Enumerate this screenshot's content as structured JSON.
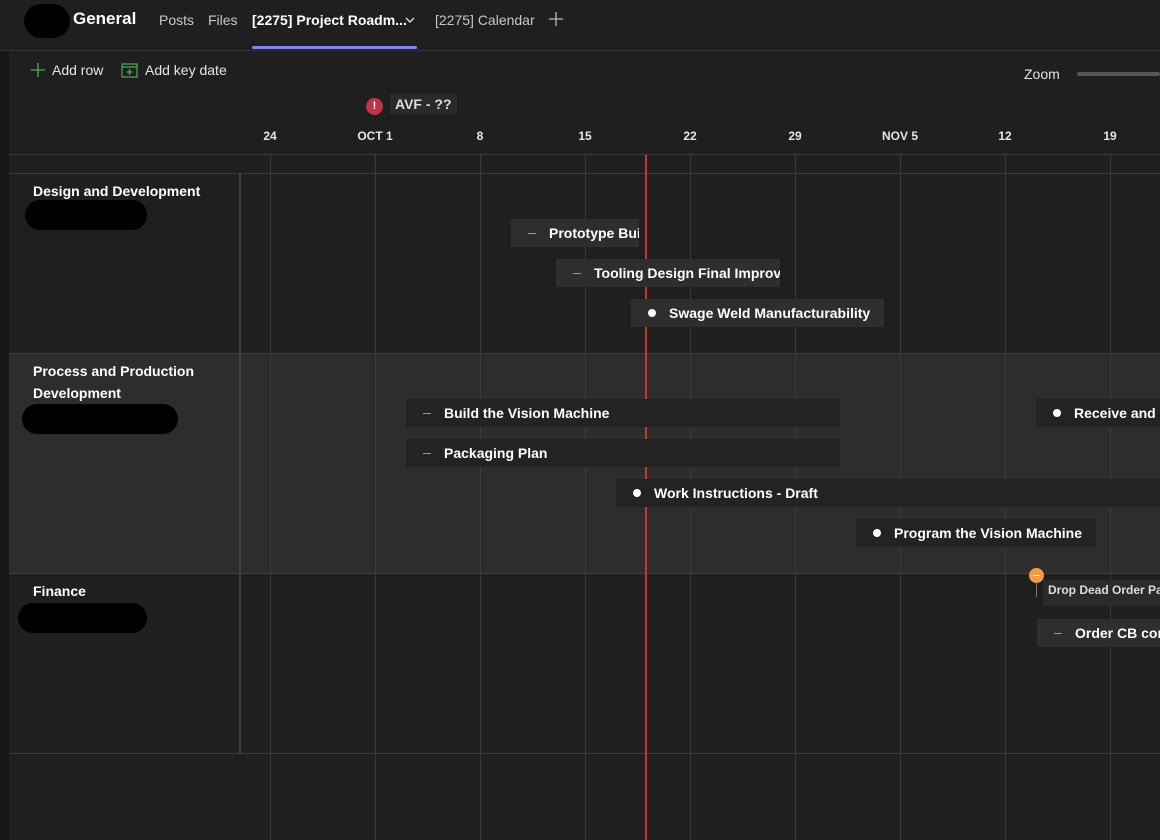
{
  "header": {
    "channel": "General",
    "tabs": [
      {
        "label": "Posts"
      },
      {
        "label": "Files"
      },
      {
        "label": "[2275] Project Roadm..."
      },
      {
        "label": "[2275] Calendar"
      }
    ]
  },
  "toolbar": {
    "add_row": "Add row",
    "add_key_date": "Add key date",
    "zoom_label": "Zoom"
  },
  "key_dates": {
    "avf": "AVF - ??",
    "avf_icon": "!",
    "finance": "Drop Dead Order Parts"
  },
  "timeline": {
    "dates": [
      "24",
      "OCT 1",
      "8",
      "15",
      "22",
      "29",
      "NOV 5",
      "12",
      "19"
    ]
  },
  "rows": [
    {
      "title": "Design and Development"
    },
    {
      "title": "Process and Production Development"
    },
    {
      "title": "Finance"
    }
  ],
  "bars": {
    "prototype": "Prototype Build",
    "tooling": "Tooling Design Final Improvements",
    "swage": "Swage Weld Manufacturability",
    "vision_build": "Build the Vision Machine",
    "receive": "Receive and Check",
    "packaging": "Packaging Plan",
    "work_instr": "Work Instructions - Draft",
    "vision_prog": "Program the Vision Machine",
    "order_cb": "Order CB components"
  },
  "colors": {
    "accent": "#7f85f5",
    "today": "#c8372d",
    "milestone_red": "#c4314b",
    "milestone_orange": "#f59b42",
    "add_key_date_icon": "#4caf50"
  }
}
